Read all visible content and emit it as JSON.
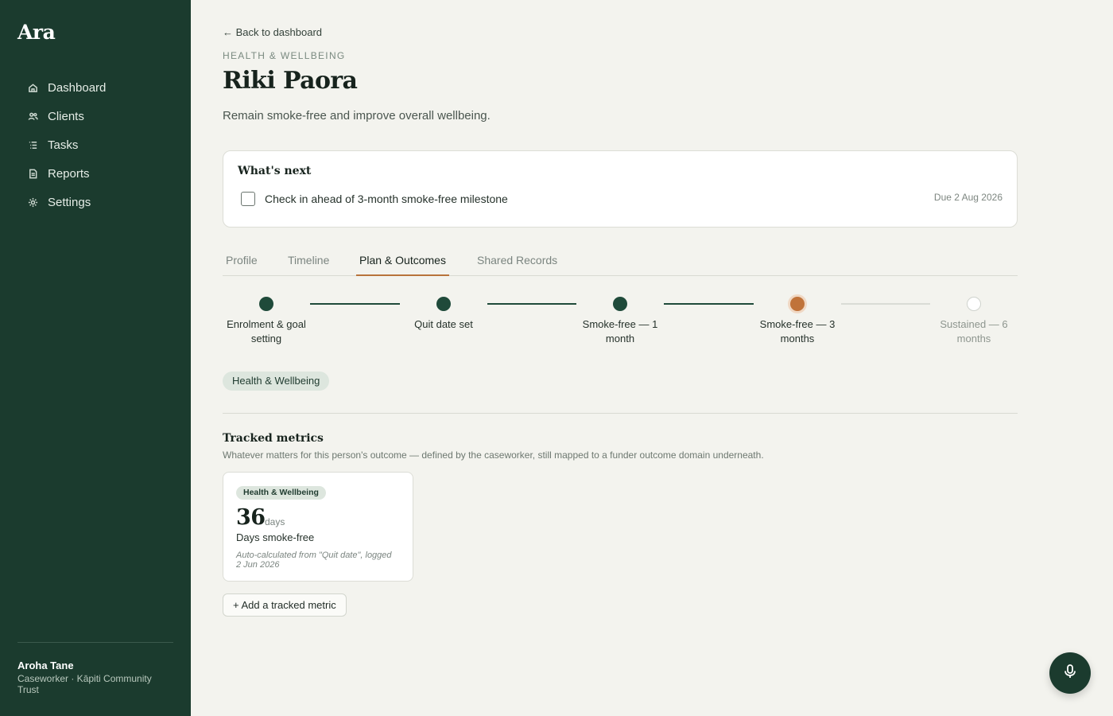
{
  "sidebar": {
    "brand": "Ara",
    "items": [
      {
        "label": "Dashboard",
        "icon": "home-icon"
      },
      {
        "label": "Clients",
        "icon": "users-icon"
      },
      {
        "label": "Tasks",
        "icon": "list-icon"
      },
      {
        "label": "Reports",
        "icon": "document-icon"
      },
      {
        "label": "Settings",
        "icon": "gear-icon"
      }
    ],
    "user": {
      "name": "Aroha Tane",
      "role": "Caseworker · Kāpiti Community Trust"
    }
  },
  "header": {
    "back_label": "← Back to dashboard",
    "section": "HEALTH & WELLBEING",
    "client_name": "Riki Paora",
    "goal": "Remain smoke-free and improve overall wellbeing."
  },
  "whats_next": {
    "title": "What's next",
    "task": "Check in ahead of 3-month smoke-free milestone",
    "due": "Due 2 Aug 2026",
    "checked": false
  },
  "tabs": [
    {
      "label": "Profile",
      "active": false
    },
    {
      "label": "Timeline",
      "active": false
    },
    {
      "label": "Plan & Outcomes",
      "active": true
    },
    {
      "label": "Shared Records",
      "active": false
    }
  ],
  "milestones": [
    {
      "label": "Enrolment & goal setting",
      "status": "done"
    },
    {
      "label": "Quit date set",
      "status": "done"
    },
    {
      "label": "Smoke-free — 1 month",
      "status": "done"
    },
    {
      "label": "Smoke-free — 3 months",
      "status": "current"
    },
    {
      "label": "Sustained — 6 months",
      "status": "upcoming"
    }
  ],
  "domain_pill": "Health & Wellbeing",
  "metrics": {
    "title": "Tracked metrics",
    "subtitle": "Whatever matters for this person's outcome — defined by the caseworker, still mapped to a funder outcome domain underneath.",
    "card": {
      "domain": "Health & Wellbeing",
      "value": "36",
      "unit": "days",
      "name": "Days smoke-free",
      "note": "Auto-calculated from \"Quit date\", logged 2 Jun 2026"
    },
    "add_label": "+ Add a tracked metric"
  },
  "colors": {
    "sidebar_bg": "#1b3b2e",
    "accent": "#b8733b",
    "done": "#1f4a3a",
    "page_bg": "#f3f3ee"
  },
  "mic_icon": "microphone-icon"
}
